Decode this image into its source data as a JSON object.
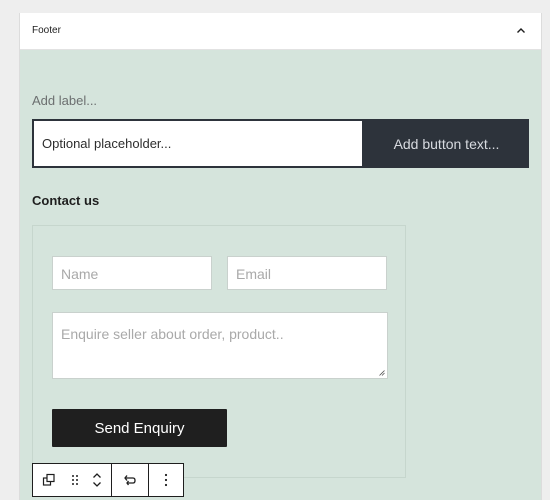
{
  "panel": {
    "title": "Footer",
    "collapse_icon": "chevron-up-icon"
  },
  "newsletter": {
    "label_placeholder": "Add label...",
    "input_placeholder": "Optional placeholder...",
    "button_text": "Add button text..."
  },
  "contact": {
    "heading": "Contact us",
    "name_placeholder": "Name",
    "email_placeholder": "Email",
    "message_placeholder": "Enquire seller about order, product..",
    "submit_label": "Send Enquiry"
  },
  "toolbar": {
    "items": [
      "copy-icon",
      "drag-handle-icon",
      "move-up-icon",
      "move-down-icon",
      "transform-icon",
      "more-options-icon"
    ]
  },
  "colors": {
    "panel_bg": "#d5e4dc",
    "dark": "#2d333b",
    "button_dark": "#1f1f1f"
  }
}
